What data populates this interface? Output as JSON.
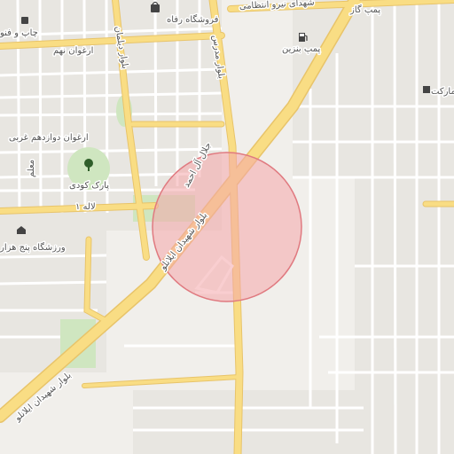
{
  "map": {
    "colors": {
      "background": "#f1efeb",
      "block": "#e8e6e1",
      "minor_road": "#ffffff",
      "major_road": "#f9dd84",
      "major_road_casing": "#e8c46a",
      "park": "#cfe6c0",
      "highlight_fill": "#f4a6aa",
      "highlight_stroke": "#e07a80"
    },
    "labels": {
      "boulevard_ilanlu_south": "بلوار شهیدان ایلانلو",
      "boulevard_ilanlu_north": "بلوار شهیدان ایلانلو",
      "jalal_al_ahmad": "جلال آل احمد",
      "boulevard_modares": "بلوار مدرس",
      "boulevard_daneshgah": "بلوار دیلمان",
      "niru_entezami": "شهدای نیرو انتظامی",
      "arghavan_nohom": "ارغوان نهم",
      "arghavan_12": "ارغوان دوازدهم غربی",
      "laleh_1": "لاله ۱",
      "malem": "معلم",
      "park_koodi": "پارک کودی",
      "varzeshgah": "ورزشگاه پنج هزار",
      "forushgah_refah": "فروشگاه رفاه",
      "chap_fanavari": "چاپ و فنو",
      "pomp_benzin": "پمپ بنزین",
      "pomp_gaz": "پمپ گاز",
      "market": "مارکت"
    },
    "icons": [
      "shopping-bag-icon",
      "fuel-pump-icon",
      "tree-icon",
      "stadium-icon",
      "market-icon"
    ]
  }
}
